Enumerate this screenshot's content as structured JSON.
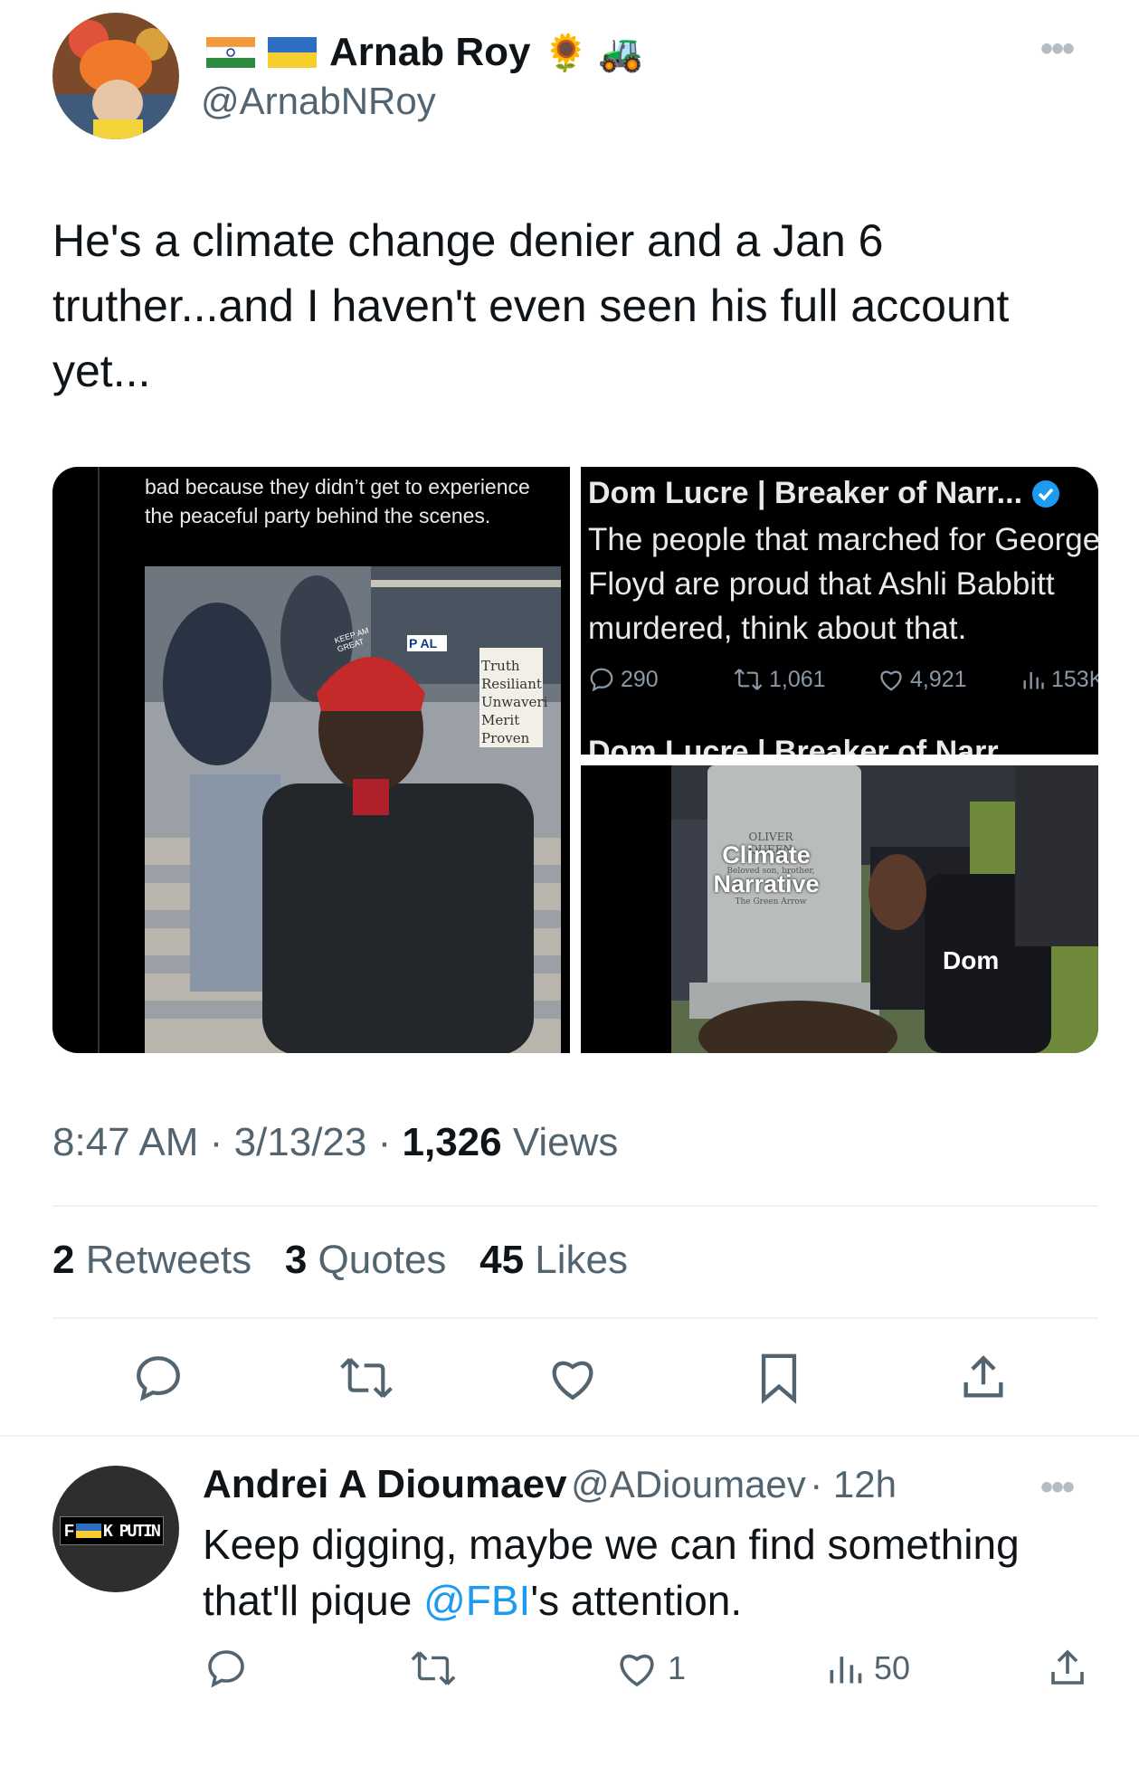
{
  "tweet": {
    "author_name": "Arnab Roy",
    "author_handle": "@ArnabNRoy",
    "name_emoji": "🌻 🚜",
    "text": "He's a climate change denier and a Jan 6 truther...and I haven't even seen his full account yet...",
    "time": "8:47 AM",
    "date": "3/13/23",
    "views_count": "1,326",
    "views_label": "Views",
    "retweets_count": "2",
    "retweets_label": "Retweets",
    "quotes_count": "3",
    "quotes_label": "Quotes",
    "likes_count": "45",
    "likes_label": "Likes",
    "more_label": "•••"
  },
  "media": {
    "left_caption": "bad because they didn’t get to experience the peaceful party behind the scenes.",
    "sign_lines": [
      "Truth",
      "Resiliant",
      "Unwaveri",
      "Merit",
      "Proven"
    ],
    "hat_text": "KEEP AM GREAT",
    "sign2_text": "P AL",
    "top_right": {
      "author": "Dom Lucre | Breaker of Narr...",
      "text": "The people that marched for George Floyd are proud that Ashli Babbitt murdered, think about that.",
      "replies": "290",
      "retweets": "1,061",
      "likes": "4,921",
      "views": "153K"
    },
    "bottom_right": {
      "peek_author": "Dom Lucre | Breaker of Narr...",
      "grave_name": "OLIVER QUEEN",
      "grave_subtitle": "Beloved son, brother,",
      "grave_signature": "The Green Arrow",
      "grave_label1": "Climate",
      "grave_label2": "Narrative",
      "person_label": "Dom"
    }
  },
  "reply": {
    "author_name": "Andrei A Dioumaev",
    "author_handle": "@ADioumaev",
    "time": "· 12h",
    "text_before": "Keep digging, maybe we can find something that'll pique ",
    "mention": "@FBI",
    "text_after": "'s attention.",
    "likes": "1",
    "views": "50",
    "avatar_text": "F",
    "avatar_text2": "K PUTIN",
    "more_label": "•••"
  },
  "colors": {
    "accent": "#1d9bf0",
    "text": "#0f1419",
    "secondary": "#536471",
    "divider": "#eff3f4"
  },
  "icons": [
    "reply-icon",
    "retweet-icon",
    "like-icon",
    "bookmark-icon",
    "share-icon",
    "views-icon",
    "more-icon",
    "verified-icon"
  ]
}
